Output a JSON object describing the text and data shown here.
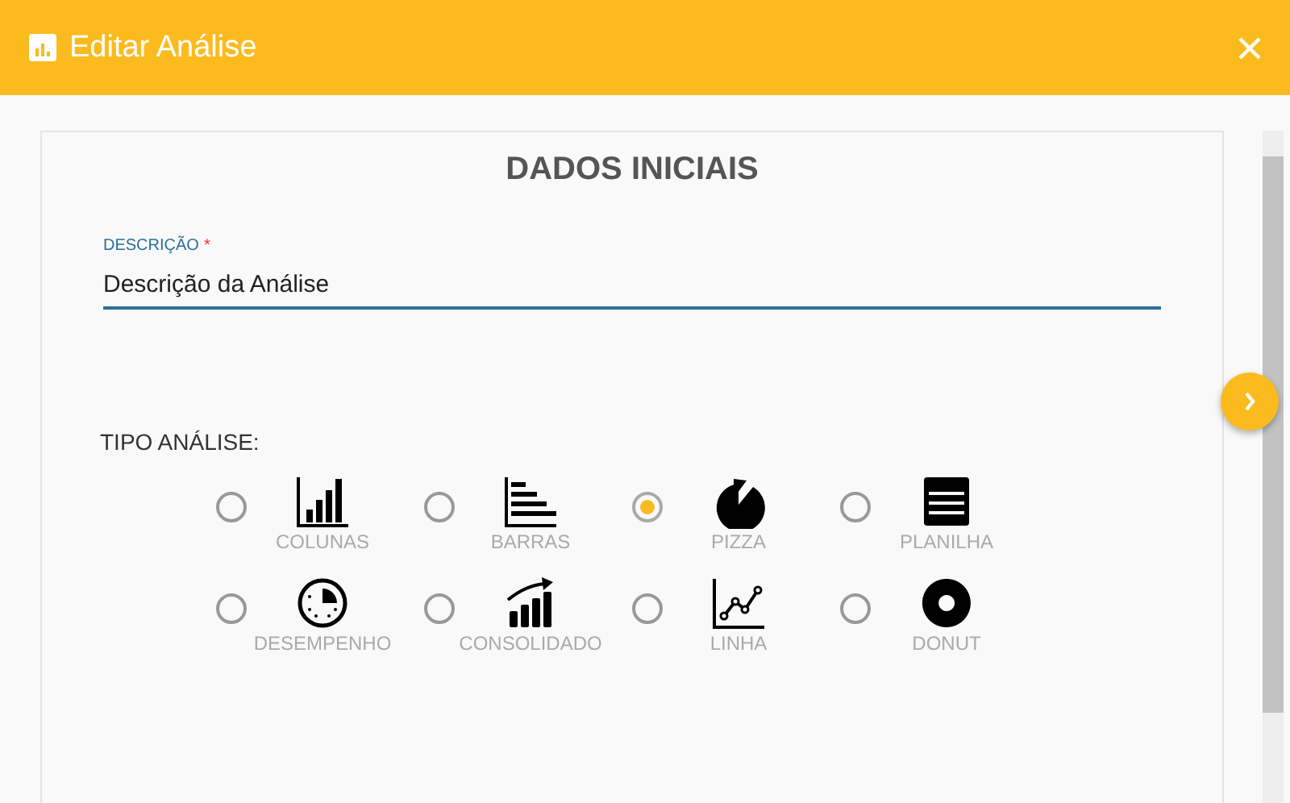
{
  "dialog": {
    "title": "Editar Análise"
  },
  "section": {
    "title": "DADOS INICIAIS"
  },
  "description_field": {
    "label": "DESCRIÇÃO",
    "required_mark": "*",
    "value": "Descrição da Análise"
  },
  "analysis_type": {
    "label": "TIPO ANÁLISE:",
    "options": [
      {
        "label": "COLUNAS",
        "selected": false
      },
      {
        "label": "BARRAS",
        "selected": false
      },
      {
        "label": "PIZZA",
        "selected": true
      },
      {
        "label": "PLANILHA",
        "selected": false
      },
      {
        "label": "DESEMPENHO",
        "selected": false
      },
      {
        "label": "CONSOLIDADO",
        "selected": false
      },
      {
        "label": "LINHA",
        "selected": false
      },
      {
        "label": "DONUT",
        "selected": false
      }
    ]
  }
}
